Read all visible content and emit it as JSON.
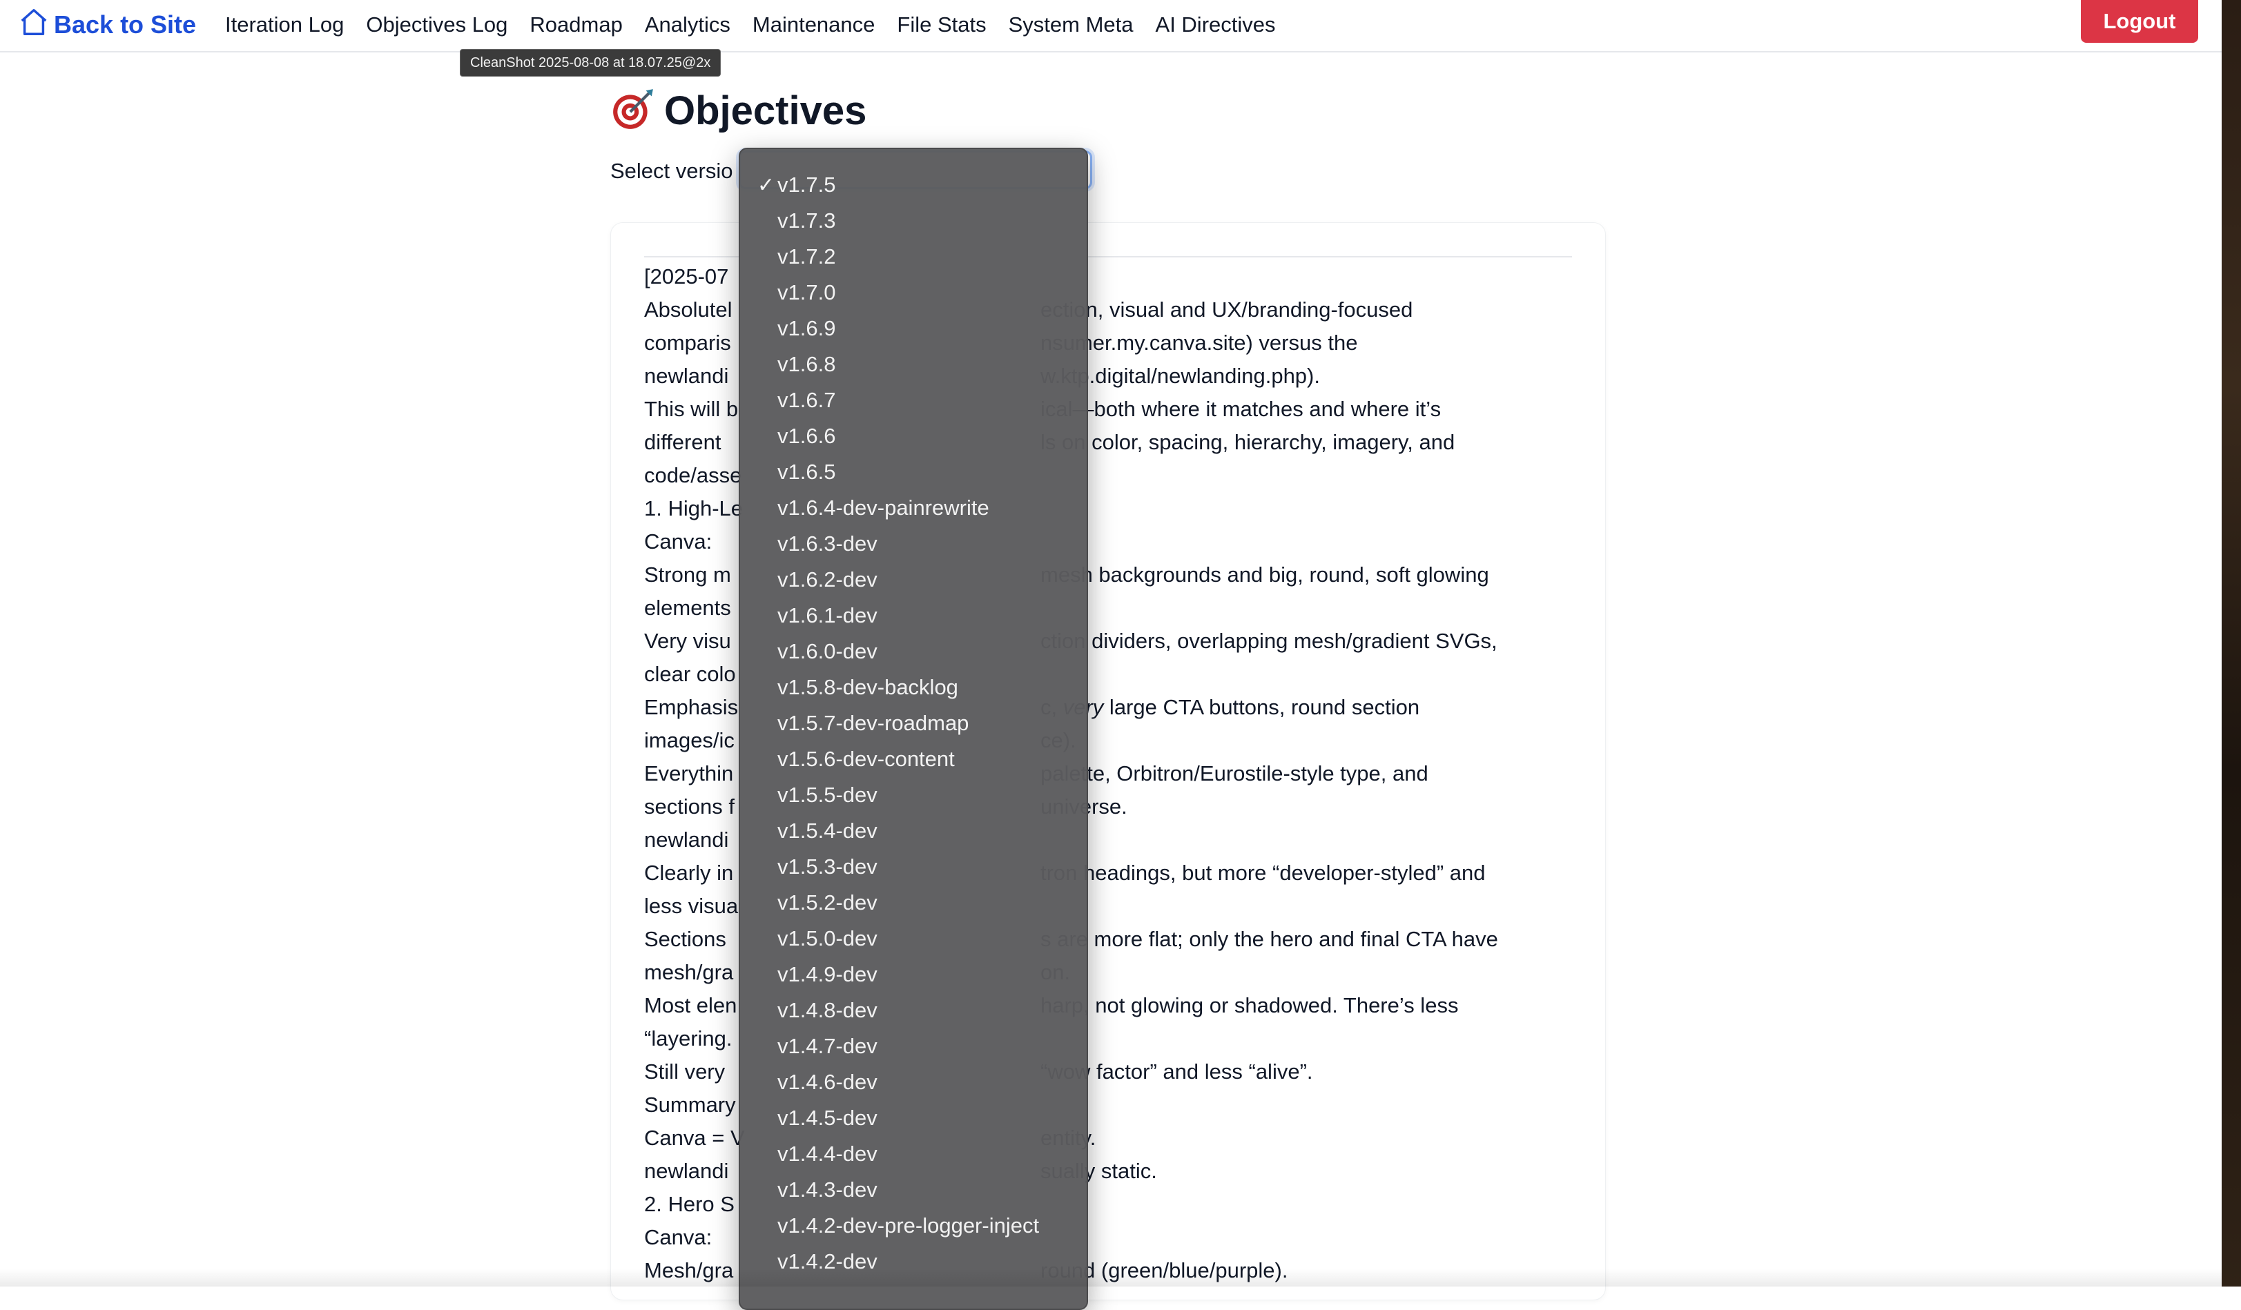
{
  "nav": {
    "home_label": "Back to Site",
    "links": [
      "Iteration Log",
      "Objectives Log",
      "Roadmap",
      "Analytics",
      "Maintenance",
      "File Stats",
      "System Meta",
      "AI Directives"
    ],
    "logout_label": "Logout"
  },
  "tooltip": "CleanShot 2025-08-08 at 18.07.25@2x",
  "page": {
    "title": "Objectives",
    "select_label": "Select versio"
  },
  "dropdown": {
    "selected": "v1.7.5",
    "check_glyph": "✓",
    "options": [
      "v1.7.5",
      "v1.7.3",
      "v1.7.2",
      "v1.7.0",
      "v1.6.9",
      "v1.6.8",
      "v1.6.7",
      "v1.6.6",
      "v1.6.5",
      "v1.6.4-dev-painrewrite",
      "v1.6.3-dev",
      "v1.6.2-dev",
      "v1.6.1-dev",
      "v1.6.0-dev",
      "v1.5.8-dev-backlog",
      "v1.5.7-dev-roadmap",
      "v1.5.6-dev-content",
      "v1.5.5-dev",
      "v1.5.4-dev",
      "v1.5.3-dev",
      "v1.5.2-dev",
      "v1.5.0-dev",
      "v1.4.9-dev",
      "v1.4.8-dev",
      "v1.4.7-dev",
      "v1.4.6-dev",
      "v1.4.5-dev",
      "v1.4.4-dev",
      "v1.4.3-dev",
      "v1.4.2-dev-pre-logger-inject",
      "v1.4.2-dev"
    ]
  },
  "content": {
    "lines": [
      {
        "left": "[2025-07",
        "right": ""
      },
      {
        "left": "Absolutel",
        "right": "ection, visual and UX/branding-focused"
      },
      {
        "left": "comparis",
        "right": "nsumer.my.canva.site) versus the"
      },
      {
        "left": "newlandi",
        "right": "w.ktp.digital/newlanding.php)."
      },
      {
        "left": "This will b",
        "right": "ical—both where it matches and where it’s"
      },
      {
        "left": "different",
        "right": "ls on color, spacing, hierarchy, imagery, and"
      },
      {
        "left": "code/asse",
        "right": ""
      },
      {
        "left": "1. High-Le",
        "right": ""
      },
      {
        "left": "Canva:",
        "right": ""
      },
      {
        "left": "Strong m",
        "right": "mesh backgrounds and big, round, soft glowing"
      },
      {
        "left": "elements",
        "right": ""
      },
      {
        "left": "Very visu",
        "right": "ction dividers, overlapping mesh/gradient SVGs,"
      },
      {
        "left": "clear colo",
        "right": ""
      },
      {
        "left": "Emphasis",
        "right": "c, very large CTA buttons, round section"
      },
      {
        "left": "images/ic",
        "right": "ce)."
      },
      {
        "left": "Everythin",
        "right": "palette, Orbitron/Eurostile-style type, and"
      },
      {
        "left": "sections f",
        "right": "universe."
      },
      {
        "left": "newlandi",
        "right": ""
      },
      {
        "left": "Clearly in",
        "right": "tron headings, but more “developer-styled” and"
      },
      {
        "left": "less visua",
        "right": ""
      },
      {
        "left": "Sections",
        "right": "s are more flat; only the hero and final CTA have"
      },
      {
        "left": "mesh/gra",
        "right": "on."
      },
      {
        "left": "Most elen",
        "right": "harp, not glowing or shadowed. There’s less"
      },
      {
        "left": "“layering.",
        "right": ""
      },
      {
        "left": "Still very",
        "right": "“wow factor” and less “alive”."
      },
      {
        "left": "Summary",
        "right": ""
      },
      {
        "left": "Canva = V",
        "right": "entity."
      },
      {
        "left": "newlandi",
        "right": "sually static."
      },
      {
        "left": "2. Hero S",
        "right": ""
      },
      {
        "left": "Canva:",
        "right": ""
      },
      {
        "left": "Mesh/gra",
        "right": "round (green/blue/purple)."
      }
    ]
  },
  "colors": {
    "accent": "#1d4ed8",
    "logout": "#dc3545",
    "dropdown_bg": "#5c5c5e"
  }
}
